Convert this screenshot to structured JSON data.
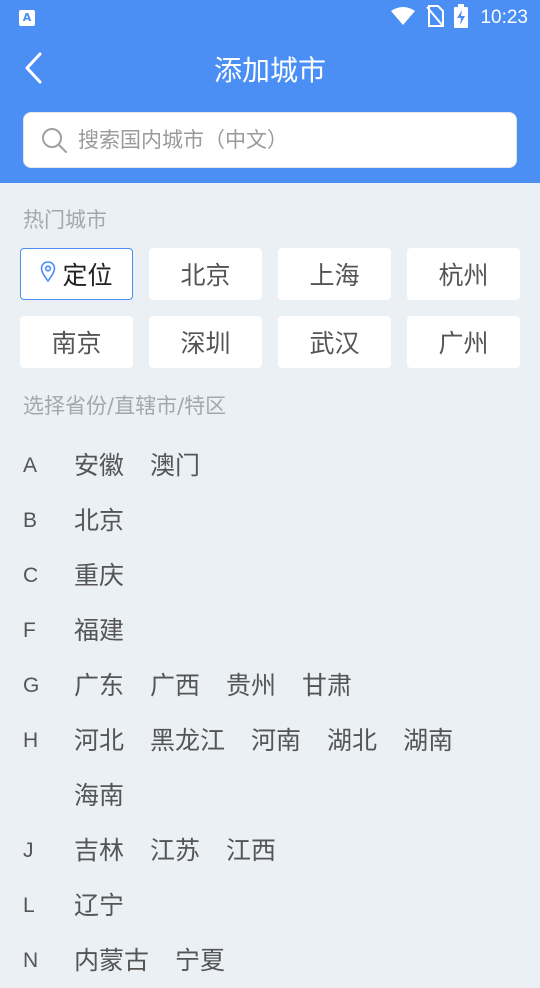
{
  "status_bar": {
    "time": "10:23",
    "app_icon_letter": "A",
    "icons": [
      "wifi-icon",
      "no-sim-icon",
      "battery-charging-icon"
    ]
  },
  "header": {
    "title": "添加城市",
    "back_icon": "chevron-left-icon"
  },
  "search": {
    "placeholder": "搜索国内城市（中文）",
    "value": ""
  },
  "hot_cities": {
    "title": "热门城市",
    "locate_label": "定位",
    "cities": [
      "北京",
      "上海",
      "杭州",
      "南京",
      "深圳",
      "武汉",
      "广州"
    ]
  },
  "regions": {
    "title": "选择省份/直辖市/特区",
    "groups": [
      {
        "letter": "A",
        "items": [
          "安徽",
          "澳门"
        ]
      },
      {
        "letter": "B",
        "items": [
          "北京"
        ]
      },
      {
        "letter": "C",
        "items": [
          "重庆"
        ]
      },
      {
        "letter": "F",
        "items": [
          "福建"
        ]
      },
      {
        "letter": "G",
        "items": [
          "广东",
          "广西",
          "贵州",
          "甘肃"
        ]
      },
      {
        "letter": "H",
        "items": [
          "河北",
          "黑龙江",
          "河南",
          "湖北",
          "湖南",
          "海南"
        ]
      },
      {
        "letter": "J",
        "items": [
          "吉林",
          "江苏",
          "江西"
        ]
      },
      {
        "letter": "L",
        "items": [
          "辽宁"
        ]
      },
      {
        "letter": "N",
        "items": [
          "内蒙古",
          "宁夏"
        ]
      }
    ]
  },
  "colors": {
    "accent": "#4b8ff5",
    "background": "#ebf0f5",
    "chip_background": "#ffffff",
    "muted_text": "#a4a8ad",
    "text": "#555555"
  }
}
